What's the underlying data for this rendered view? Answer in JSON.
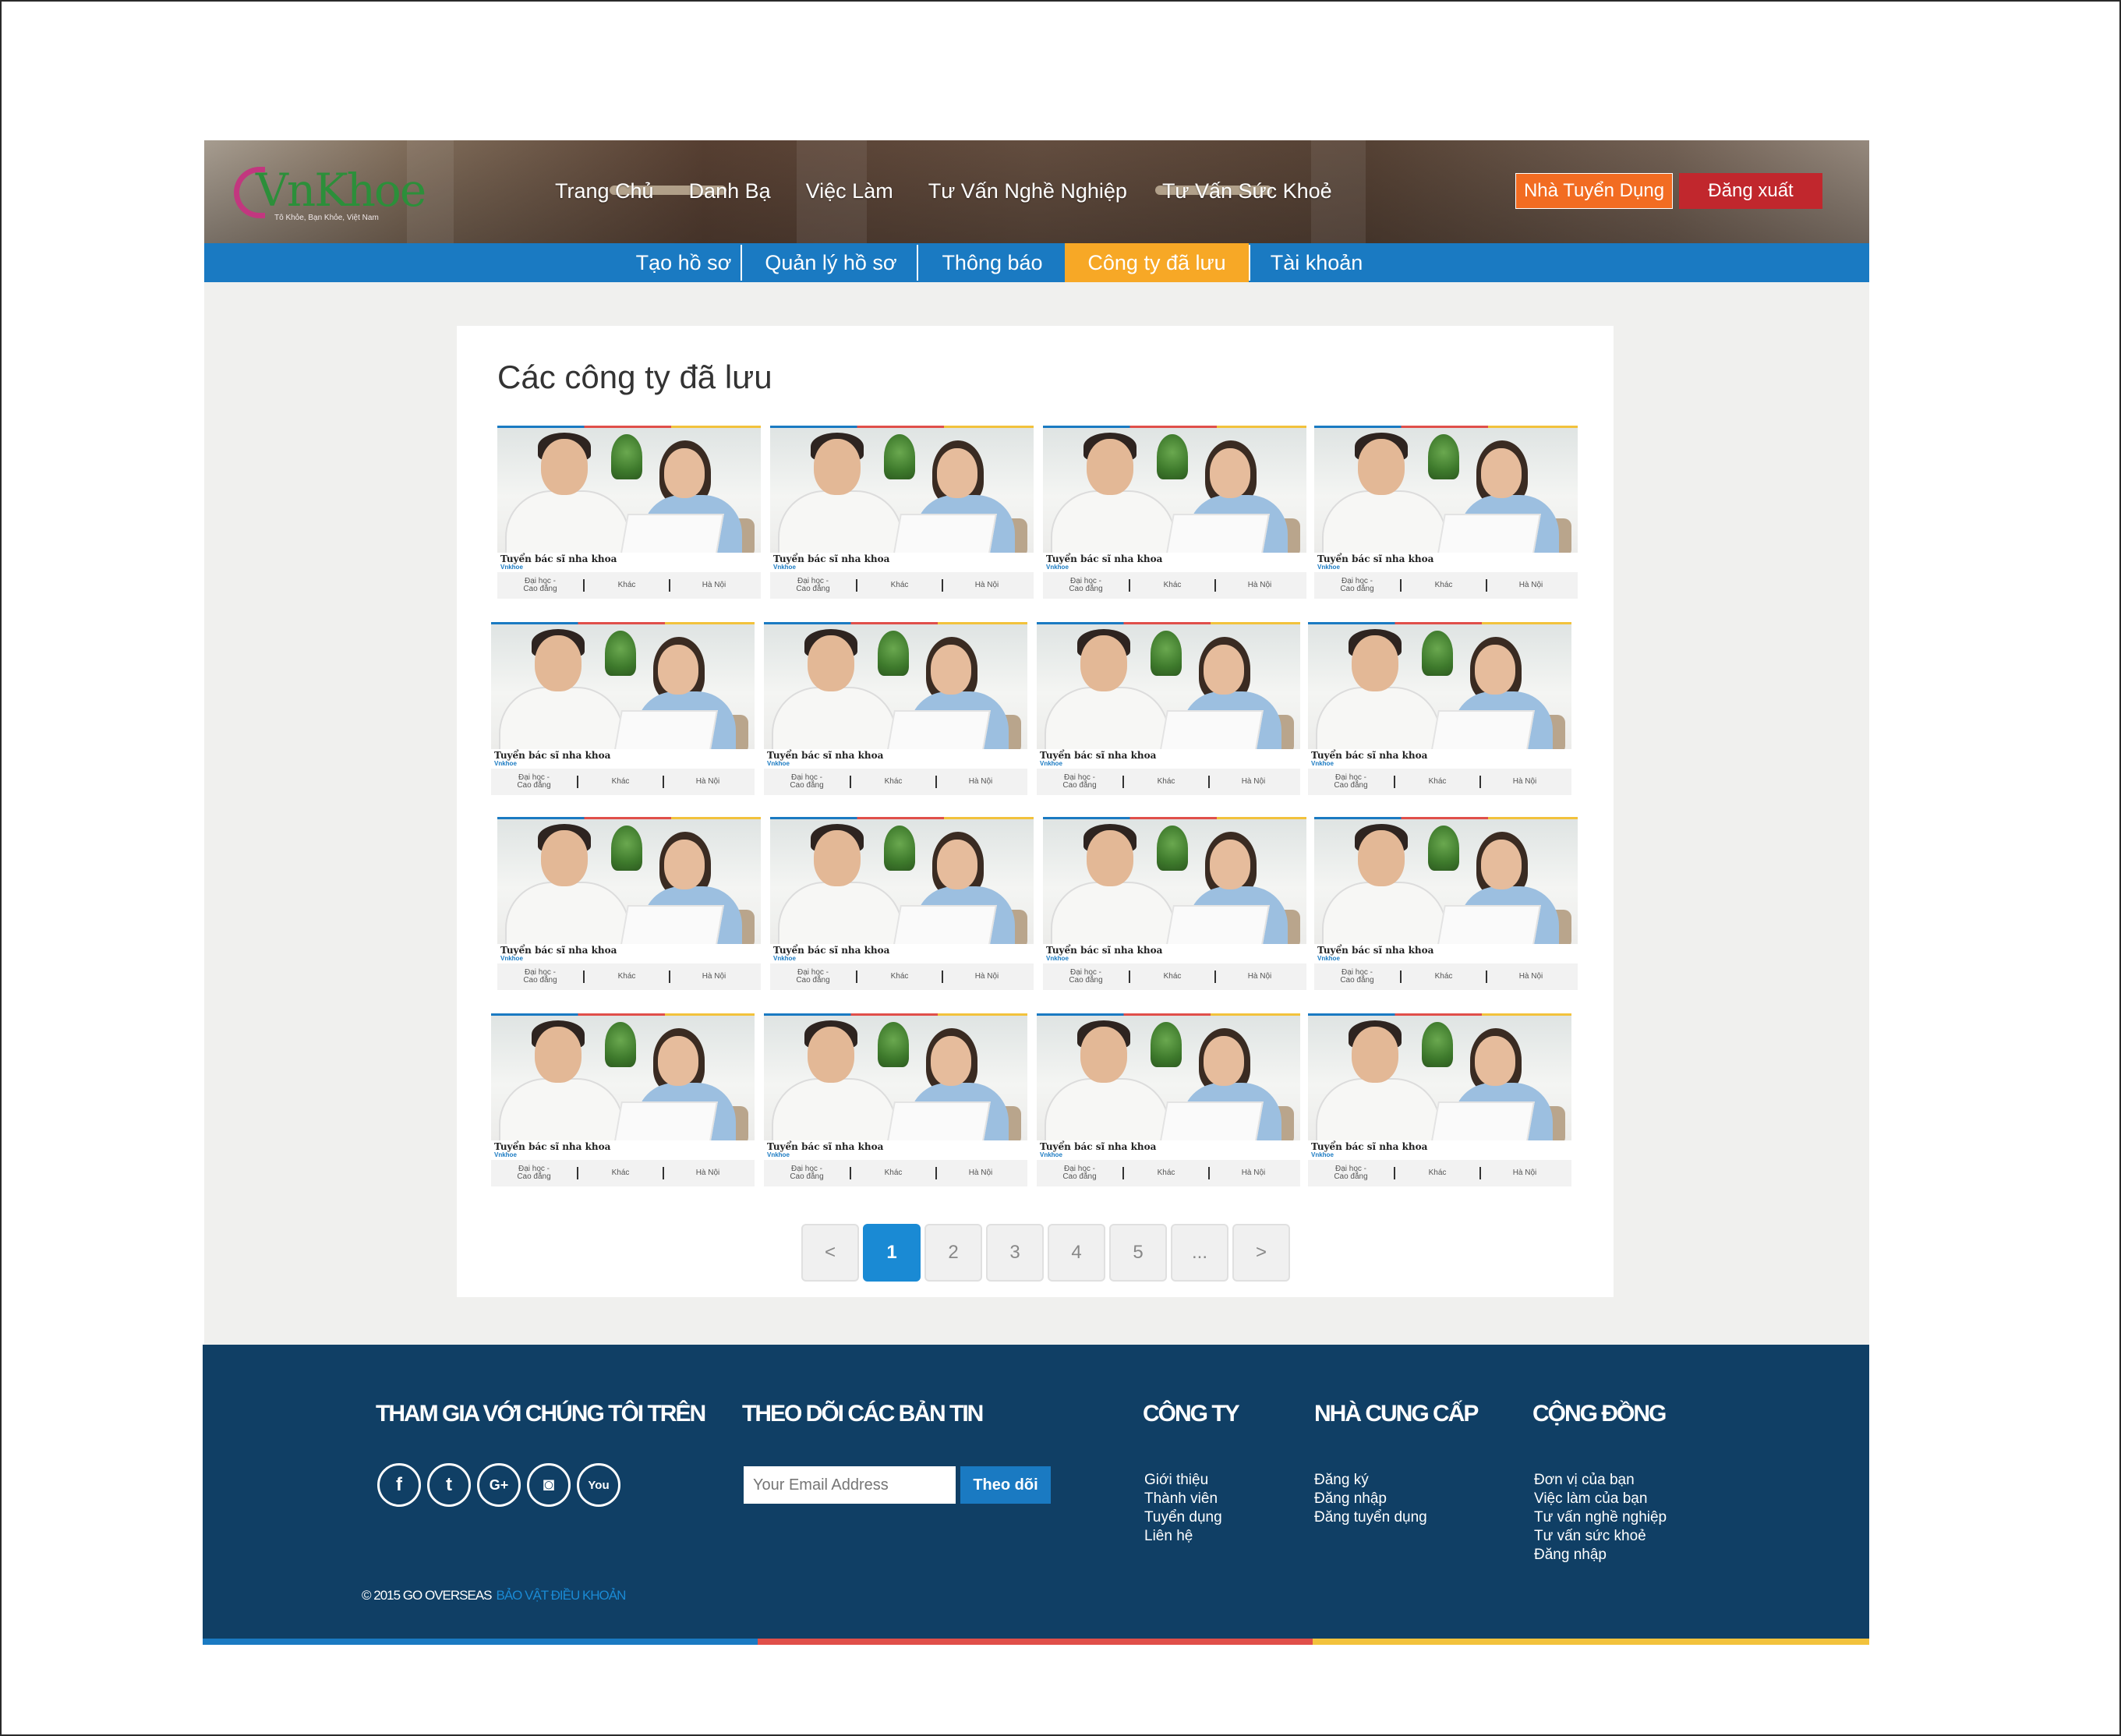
{
  "header": {
    "logo": {
      "brand": "VnKhoe",
      "tagline": "Tô Khỏe, Bạn Khỏe, Việt Nam"
    },
    "nav": [
      "Trang Chủ",
      "Danh Bạ",
      "Việc Làm",
      "Tư Vấn Nghề Nghiệp",
      "Tư Vấn Sức Khoẻ"
    ],
    "employer_button": "Nhà Tuyển Dụng",
    "logout_button": "Đăng xuất"
  },
  "subnav": {
    "items": [
      "Tạo hồ sơ",
      "Quản lý hồ sơ",
      "Thông báo",
      "Công ty đã lưu",
      "Tài khoản"
    ],
    "active": "Công ty đã lưu"
  },
  "main": {
    "title": "Các công ty đã lưu",
    "card_template": {
      "job_title": "Tuyển bác sĩ nha khoa",
      "brand": "Vnkhoe",
      "education": "Đại học - Cao đẳng",
      "category": "Khác",
      "location": "Hà Nội"
    },
    "card_count": 16,
    "pagination": [
      "<",
      "1",
      "2",
      "3",
      "4",
      "5",
      "...",
      ">"
    ],
    "current_page": "1"
  },
  "footer": {
    "join_heading": "THAM GIA VỚI CHÚNG TÔI TRÊN",
    "social": [
      "facebook",
      "twitter",
      "google-plus",
      "instagram",
      "youtube"
    ],
    "newsletter_heading": "THEO DÕI CÁC BẢN TIN",
    "email_placeholder": "Your Email Address",
    "subscribe_label": "Theo dõi",
    "company_heading": "CÔNG TY",
    "company_links": [
      "Giới thiệu",
      "Thành viên",
      "Tuyển dụng",
      "Liên hệ"
    ],
    "provider_heading": "NHÀ CUNG CẤP",
    "provider_links": [
      "Đăng ký",
      "Đăng nhập",
      "Đăng tuyển dụng"
    ],
    "community_heading": "CỘNG ĐỒNG",
    "community_links": [
      "Đơn vị của bạn",
      "Việc làm của bạn",
      "Tư vấn nghề nghiệp",
      "Tư vấn sức khoẻ",
      "Đăng nhập"
    ],
    "copyright": "© 2015 GO OVERSEAS",
    "terms": "BẢO VẬT ĐIỀU KHOẢN"
  },
  "colors": {
    "primary_blue": "#1a7ac2",
    "active_orange": "#f7a826",
    "employer_orange": "#f26c22",
    "logout_red": "#c1272d",
    "footer_navy": "#103f65"
  }
}
